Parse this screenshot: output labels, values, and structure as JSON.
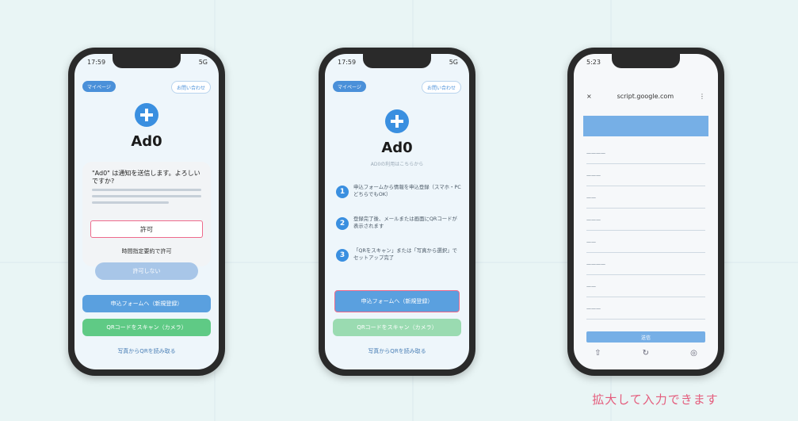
{
  "phone1": {
    "status_time": "17:59",
    "status_right": "5G",
    "pill_left": "マイページ",
    "pill_right": "お問い合わせ",
    "app_name": "Ad0",
    "dialog_title": "\"Ad0\" は通知を送信します。よろしいですか?",
    "allow_label": "許可",
    "sub_option": "時間指定要約で許可",
    "deny_label": "許可しない",
    "btn_form": "申込フォームへ（新規登録）",
    "btn_qr": "QRコードをスキャン（カメラ）",
    "link_photo": "写真からQRを読み取る"
  },
  "phone2": {
    "status_time": "17:59",
    "status_right": "5G",
    "pill_left": "マイページ",
    "pill_right": "お問い合わせ",
    "app_name": "Ad0",
    "sub_caption": "AD0の利用はこちらから",
    "steps": [
      {
        "num": "1",
        "text": "申込フォームから情報を申込登録（スマホ・PCどちらでもOK）"
      },
      {
        "num": "2",
        "text": "登録完了後、メールまたは画面にQRコードが表示されます"
      },
      {
        "num": "3",
        "text": "「QRをスキャン」または「写真から選択」でセットアップ完了"
      }
    ],
    "btn_form": "申込フォームへ（新規登録）",
    "btn_qr": "QRコードをスキャン（カメラ）",
    "link_photo": "写真からQRを読み取る"
  },
  "phone3": {
    "status_time": "5:23",
    "status_right": "",
    "close_glyph": "×",
    "url": "script.google.com",
    "menu_glyph": "⋮",
    "submit_label": "送信",
    "footer_icons": [
      "share-icon",
      "reload-icon",
      "compass-icon"
    ]
  },
  "caption": "拡大して入力できます",
  "colors": {
    "accent_blue": "#3a8fe0",
    "green": "#5fca85",
    "highlight_pink": "#ee6a8c",
    "caption_pink": "#e45c7c"
  }
}
